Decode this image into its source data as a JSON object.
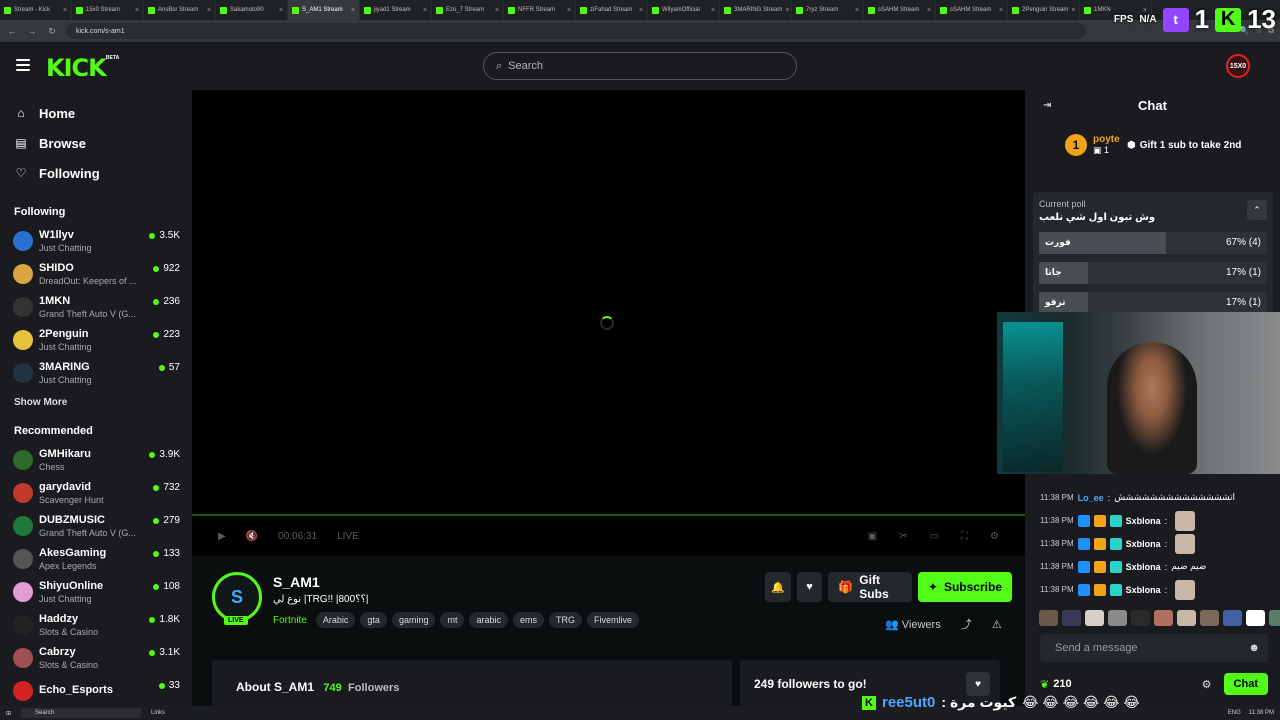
{
  "browser": {
    "tabs": [
      "Stream - Kick",
      "15x0 Stream",
      "AnsBsr Stream",
      "Sakamoto90",
      "S_AM1 Stream",
      "jiyad1 Stream",
      "Ezo_7 Stream",
      "NFFR Stream",
      "ziFahad Stream",
      "WilyamOfficial",
      "3MARING Stream",
      "7ryz Stream",
      "sSAHM Stream",
      "sSAHM Stream",
      "2Penguin Stream",
      "1MKN"
    ],
    "active_tab": 4,
    "url": "kick.com/s-am1"
  },
  "overlay": {
    "fps_label": "FPS",
    "fps_value": "N/A",
    "twitch_count": "1",
    "kick_count": "13",
    "twitch_glyph": "t",
    "kick_glyph": "K"
  },
  "header": {
    "logo": "KICK",
    "beta": "BETA",
    "search_placeholder": "Search",
    "avatar_text": "15X0"
  },
  "sidebar": {
    "nav": [
      {
        "label": "Home",
        "icon": "home-icon",
        "glyph": "⌂"
      },
      {
        "label": "Browse",
        "icon": "browse-icon",
        "glyph": "▤"
      },
      {
        "label": "Following",
        "icon": "heart-icon",
        "glyph": "♡"
      }
    ],
    "following_title": "Following",
    "following": [
      {
        "name": "W1llyv",
        "category": "Just Chatting",
        "viewers": "3.5K",
        "color": "#2b6fd1"
      },
      {
        "name": "SHIDO",
        "category": "DreadOut: Keepers of ...",
        "viewers": "922",
        "color": "#d9a441"
      },
      {
        "name": "1MKN",
        "category": "Grand Theft Auto V (G...",
        "viewers": "236",
        "color": "#333333"
      },
      {
        "name": "2Penguin",
        "category": "Just Chatting",
        "viewers": "223",
        "color": "#e6c23a"
      },
      {
        "name": "3MARING",
        "category": "Just Chatting",
        "viewers": "57",
        "color": "#223344"
      }
    ],
    "show_more": "Show More",
    "recommended_title": "Recommended",
    "recommended": [
      {
        "name": "GMHikaru",
        "category": "Chess",
        "viewers": "3.9K",
        "color": "#2d6b2d"
      },
      {
        "name": "garydavid",
        "category": "Scavenger Hunt",
        "viewers": "732",
        "color": "#c0392b"
      },
      {
        "name": "DUBZMUSIC",
        "category": "Grand Theft Auto V (G...",
        "viewers": "279",
        "color": "#1e7a3a"
      },
      {
        "name": "AkesGaming",
        "category": "Apex Legends",
        "viewers": "133",
        "color": "#555555"
      },
      {
        "name": "ShiyuOnline",
        "category": "Just Chatting",
        "viewers": "108",
        "color": "#e39bd8"
      },
      {
        "name": "Haddzy",
        "category": "Slots & Casino",
        "viewers": "1.8K",
        "color": "#222222"
      },
      {
        "name": "Cabrzy",
        "category": "Slots & Casino",
        "viewers": "3.1K",
        "color": "#a05050"
      },
      {
        "name": "Echo_Esports",
        "category": "",
        "viewers": "33",
        "color": "#d22222"
      }
    ]
  },
  "player": {
    "time": "00:06:31",
    "live": "LIVE"
  },
  "stream": {
    "avatar_glyph": "S",
    "name": "S_AM1",
    "title": "نوع لي |TRG!! |800؟؟|",
    "live_badge": "LIVE",
    "game": "Fortnite",
    "tags": [
      "Arabic",
      "gta",
      "gaming",
      "mt",
      "arabic",
      "ems",
      "TRG",
      "Fivemlive"
    ],
    "gift_label": "Gift Subs",
    "subscribe_label": "Subscribe",
    "viewers_label": "Viewers"
  },
  "about": {
    "title": "About S_AM1",
    "followers_count": "749",
    "followers_label": "Followers"
  },
  "goal": {
    "text": "249 followers to go!"
  },
  "chat": {
    "title": "Chat",
    "pinned_rank": "1",
    "pinned_user": "poyte",
    "pinned_count": "1",
    "gift_goal": "Gift 1 sub to take 2nd",
    "poll": {
      "label": "Current poll",
      "question": "وش تبون اول شي نلعب",
      "options": [
        {
          "label": "فورت",
          "percent": 67,
          "text": "67% (4)"
        },
        {
          "label": "جاتا",
          "percent": 17,
          "text": "17% (1)"
        },
        {
          "label": "ترقو",
          "percent": 17,
          "text": "17% (1)"
        }
      ]
    },
    "messages": [
      {
        "time": "11:38 PM",
        "user": "Lo_ee",
        "text": "اتشششششششششششششش",
        "color": "#4aa8ff",
        "badges": false,
        "emote": false
      },
      {
        "time": "11:38 PM",
        "user": "Sxblona",
        "text": "",
        "color": "#ffffff",
        "badges": true,
        "emote": true
      },
      {
        "time": "11:38 PM",
        "user": "Sxblona",
        "text": "",
        "color": "#ffffff",
        "badges": true,
        "emote": true
      },
      {
        "time": "11:38 PM",
        "user": "Sxblona",
        "text": "ضيم ضيم",
        "color": "#ffffff",
        "badges": true,
        "emote": false
      },
      {
        "time": "11:38 PM",
        "user": "Sxblona",
        "text": "",
        "color": "#ffffff",
        "badges": true,
        "emote": true
      }
    ],
    "input_placeholder": "Send a message",
    "points": "210",
    "send_label": "Chat"
  },
  "bottom_overlay": {
    "glyph": "K",
    "user": "ree5ut0",
    "text": ": كيوت مرة",
    "emojis": "😂 😂 😂 😂 😂 😂"
  },
  "taskbar": {
    "search": "Search",
    "links": "Links",
    "lang": "ENG",
    "time": "11:38 PM"
  },
  "colors": {
    "accent": "#53fc18",
    "bg": "#0b0e0f",
    "panel": "#191b1f"
  }
}
